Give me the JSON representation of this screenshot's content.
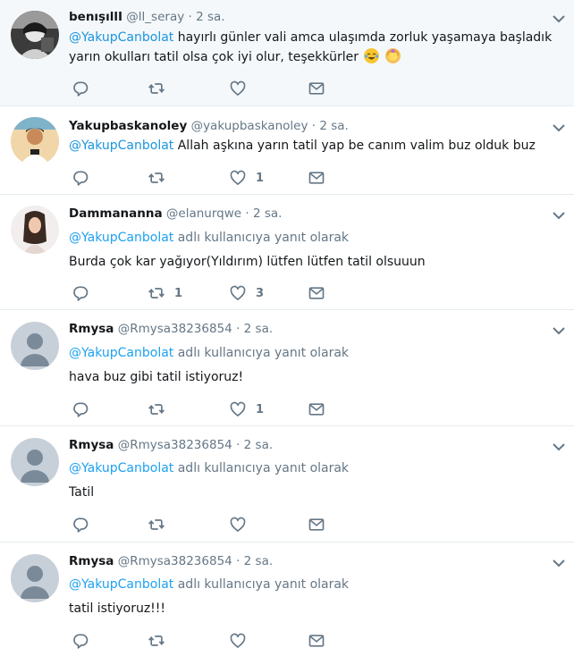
{
  "colors": {
    "link": "#1da1f2",
    "icon": "#657786",
    "separator": "#e6ecf0",
    "highlight_bg": "#f5f8fa"
  },
  "tweets": [
    {
      "name": "benışıllI",
      "handle": "@ll_seray",
      "dot": "·",
      "time": "2 sa.",
      "mention": "@YakupCanbolat",
      "text_line1": " hayırlı günler vali amca ulaşımda zorluk yaşamaya başladık",
      "text_line2": "yarın okulları tatil olsa çok iyi olur, teşekkürler",
      "emojis": [
        "face-with-tears-of-joy",
        "person-gesturing-ok"
      ],
      "retweets": "",
      "likes": ""
    },
    {
      "name": "Yakupbaskanoley",
      "handle": "@yakupbaskanoley",
      "dot": "·",
      "time": "2 sa.",
      "mention": "@YakupCanbolat",
      "text_line1": " Allah aşkına yarın tatil yap be canım valim buz olduk buz",
      "retweets": "",
      "likes": "1"
    },
    {
      "name": "Dammananna",
      "handle": "@elanurqwe",
      "dot": "·",
      "time": "2 sa.",
      "reply_mention": "@YakupCanbolat",
      "reply_suffix": " adlı kullanıcıya yanıt olarak",
      "text_line1": "Burda çok kar yağıyor(Yıldırım) lütfen lütfen tatil olsuuun",
      "retweets": "1",
      "likes": "3"
    },
    {
      "name": "Rmysa",
      "handle": "@Rmysa38236854",
      "dot": "·",
      "time": "2 sa.",
      "reply_mention": "@YakupCanbolat",
      "reply_suffix": " adlı kullanıcıya yanıt olarak",
      "text_line1": "hava buz gibi tatil istiyoruz!",
      "retweets": "",
      "likes": "1"
    },
    {
      "name": "Rmysa",
      "handle": "@Rmysa38236854",
      "dot": "·",
      "time": "2 sa.",
      "reply_mention": "@YakupCanbolat",
      "reply_suffix": " adlı kullanıcıya yanıt olarak",
      "text_line1": "Tatil",
      "retweets": "",
      "likes": ""
    },
    {
      "name": "Rmysa",
      "handle": "@Rmysa38236854",
      "dot": "·",
      "time": "2 sa.",
      "reply_mention": "@YakupCanbolat",
      "reply_suffix": " adlı kullanıcıya yanıt olarak",
      "text_line1": "tatil istiyoruz!!!",
      "retweets": "",
      "likes": ""
    }
  ]
}
